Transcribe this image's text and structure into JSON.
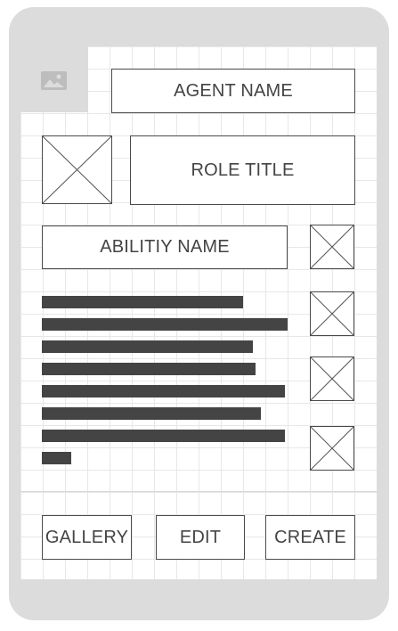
{
  "header": {
    "agent_name": "AGENT NAME"
  },
  "role": {
    "title": "ROLE TITLE",
    "portrait_icon": "image-placeholder"
  },
  "ability": {
    "name": "ABILITIY NAME"
  },
  "description": {
    "line_fill_fractions": [
      0.82,
      1.0,
      0.86,
      0.87,
      0.99,
      0.89,
      0.99,
      0.12
    ]
  },
  "actions": {
    "gallery_label": "GALLERY",
    "edit_label": "EDIT",
    "create_label": "CREATE"
  },
  "icons": {
    "notch_icon": "image-icon"
  }
}
